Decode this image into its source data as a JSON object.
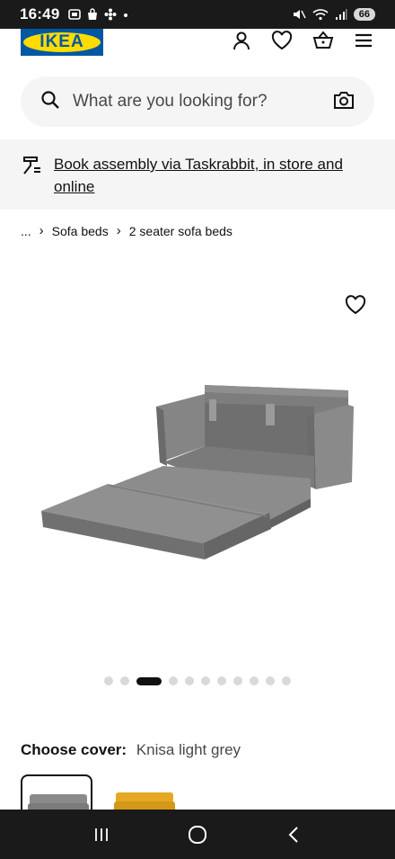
{
  "status": {
    "time": "16:49",
    "battery": "66"
  },
  "header": {
    "logo_text": "IKEA",
    "brand_blue": "#0058a3",
    "brand_yellow": "#ffdb00",
    "icons": [
      "profile-icon",
      "heart-icon",
      "basket-icon",
      "menu-icon"
    ]
  },
  "search": {
    "placeholder": "What are you looking for?"
  },
  "banner": {
    "text": "Book assembly via Taskrabbit, in store and online"
  },
  "breadcrumb": {
    "items": [
      "...",
      "Sofa beds",
      "2 seater sofa beds"
    ]
  },
  "gallery": {
    "total_images": 12,
    "active_index": 2
  },
  "cover": {
    "label": "Choose cover:",
    "value": "Knisa light grey",
    "swatch_colors": [
      "#8a8a8a",
      "#e6a822"
    ]
  }
}
